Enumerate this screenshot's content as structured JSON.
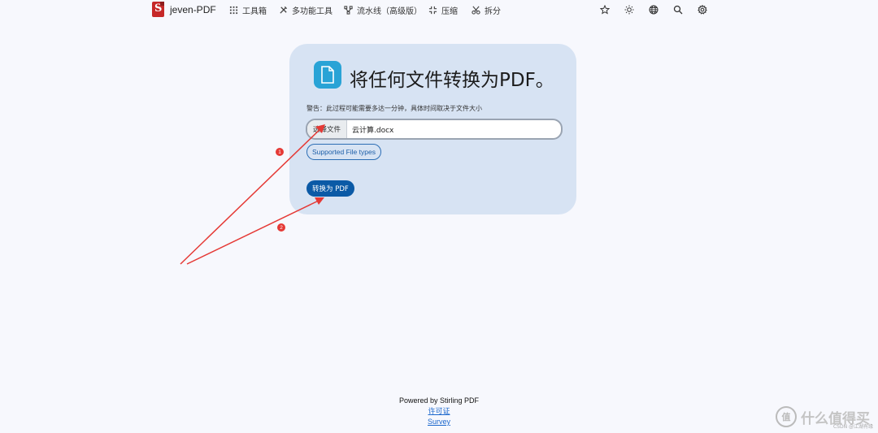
{
  "nav": {
    "brand": "jeven-PDF",
    "items": [
      {
        "label": "工具箱",
        "icon": "grid-icon"
      },
      {
        "label": "多功能工具",
        "icon": "tools-icon"
      },
      {
        "label": "流水线（高级版）",
        "icon": "pipeline-icon"
      },
      {
        "label": "压缩",
        "icon": "compress-icon"
      },
      {
        "label": "拆分",
        "icon": "scissors-icon"
      }
    ],
    "right_icons": [
      "star-icon",
      "sun-icon",
      "globe-icon",
      "search-icon",
      "settings-icon"
    ]
  },
  "card": {
    "title": "将任何文件转换为PDF。",
    "warning": "警告：此过程可能需要多达一分钟，具体时间取决于文件大小",
    "file_button": "选择文件",
    "file_name": "云计算.docx",
    "types_button": "Supported File types",
    "convert_button": "转换为 PDF"
  },
  "annotations": {
    "badge1": "1",
    "badge2": "2",
    "color": "#e53935"
  },
  "footer": {
    "powered": "Powered by Stirling PDF",
    "license": "许可证",
    "survey": "Survey"
  },
  "watermark": {
    "text": "什么值得买",
    "sub": "CSDN @江湖有缘"
  }
}
